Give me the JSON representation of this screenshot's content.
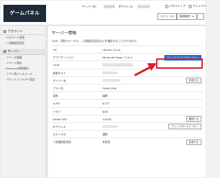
{
  "header": {
    "logo": "ゲームパネル",
    "server_label": "サーバー名：",
    "address_label": "IPアドレス：",
    "link_panel_top": "パネルトップ",
    "link_manual": "マニュアル",
    "console_button": "コンソール",
    "power_select": "電源操作"
  },
  "sidebar": {
    "account_heading": "アカウント",
    "account_items": [
      "パスワード変更",
      "二段階認証設定"
    ],
    "server_heading": "サーバー",
    "server_items": [
      "リソース情報",
      "イメージ保存",
      "Minecraft環境移行",
      "アプリ再インストール",
      "パケットフィルター設定"
    ]
  },
  "main": {
    "title": "サーバー情報",
    "description": "OSの、契約ステータス、二段階認証設定などを確認することができます。",
    "rows": [
      {
        "label": "OS",
        "value": "Ubuntu 22.04"
      },
      {
        "label": "アプリケーション",
        "value": "Minecraft Paper 1.19.4",
        "button": "マインクラフトマネージャー"
      },
      {
        "label": "UUID",
        "value": ""
      },
      {
        "label": "仮想ホスト",
        "value": ""
      },
      {
        "label": "サーバー名",
        "value": "",
        "button": "変更する"
      },
      {
        "label": "プラン名",
        "value": "GAME 8GB"
      },
      {
        "label": "契約",
        "value": "通常"
      },
      {
        "label": "vCPU",
        "value": "6コア"
      },
      {
        "label": "メモリ",
        "value": "8GB"
      },
      {
        "label": "NVMe SSD",
        "value": "100GB",
        "button": "確認する"
      },
      {
        "label": "IPアドレス",
        "value": "",
        "button": "クリップボードにコピー"
      },
      {
        "label": "ステータス",
        "value": "通常"
      },
      {
        "label": "二段階認証設定",
        "value": "未設定",
        "button": "変更する"
      }
    ]
  },
  "colors": {
    "primary_button": "#1c6fd1",
    "highlight": "#d91f2a",
    "logo_bg": "#1e2a3a"
  }
}
